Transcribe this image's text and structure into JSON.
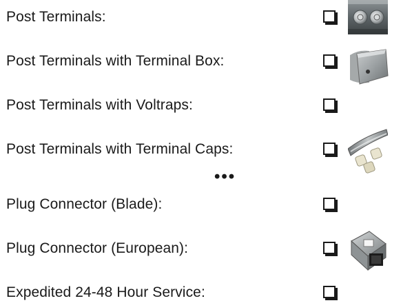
{
  "options": [
    {
      "label": "Post Terminals:",
      "checked": false,
      "thumbnail": "post-terminals-photo"
    },
    {
      "label": "Post Terminals with Terminal Box:",
      "checked": false,
      "thumbnail": "terminal-box-photo"
    },
    {
      "label": "Post Terminals with Voltraps:",
      "checked": false,
      "thumbnail": null
    },
    {
      "label": "Post Terminals with Terminal Caps:",
      "checked": false,
      "thumbnail": "terminal-caps-photo"
    },
    {
      "label": "Plug Connector (Blade):",
      "checked": false,
      "thumbnail": null
    },
    {
      "label": "Plug Connector (European):",
      "checked": false,
      "thumbnail": "european-plug-photo"
    },
    {
      "label": "Expedited 24-48 Hour Service:",
      "checked": false,
      "thumbnail": null
    }
  ],
  "separator": "•••"
}
